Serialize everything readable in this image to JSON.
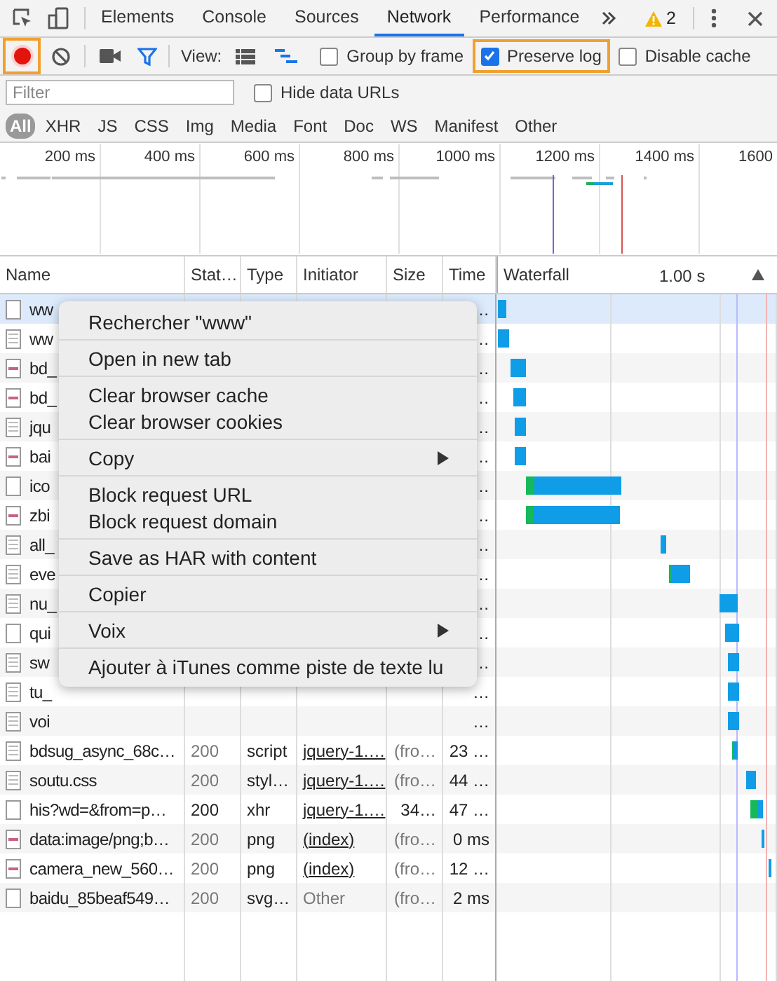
{
  "tab_bar": {
    "tabs": [
      {
        "label": "Elements",
        "selected": false
      },
      {
        "label": "Console",
        "selected": false
      },
      {
        "label": "Sources",
        "selected": false
      },
      {
        "label": "Network",
        "selected": true
      },
      {
        "label": "Performance",
        "selected": false
      }
    ],
    "warning_count": "2"
  },
  "toolbar": {
    "recording": true,
    "record_highlighted": true,
    "view_label": "View:",
    "checkboxes": [
      {
        "label": "Group by frame",
        "checked": false,
        "highlighted": false
      },
      {
        "label": "Preserve log",
        "checked": true,
        "highlighted": true
      },
      {
        "label": "Disable cache",
        "checked": false,
        "highlighted": false
      }
    ]
  },
  "filter": {
    "placeholder": "Filter",
    "hide_data_urls": {
      "label": "Hide data URLs",
      "checked": false
    }
  },
  "type_filters": [
    {
      "label": "All",
      "selected": true
    },
    {
      "label": "XHR",
      "selected": false
    },
    {
      "label": "JS",
      "selected": false
    },
    {
      "label": "CSS",
      "selected": false
    },
    {
      "label": "Img",
      "selected": false
    },
    {
      "label": "Media",
      "selected": false
    },
    {
      "label": "Font",
      "selected": false
    },
    {
      "label": "Doc",
      "selected": false
    },
    {
      "label": "WS",
      "selected": false
    },
    {
      "label": "Manifest",
      "selected": false
    },
    {
      "label": "Other",
      "selected": false
    }
  ],
  "overview": {
    "ticks": [
      "200 ms",
      "400 ms",
      "600 ms",
      "800 ms",
      "1000 ms",
      "1200 ms",
      "1400 ms",
      "1600"
    ]
  },
  "table": {
    "columns": [
      "Name",
      "Stat…",
      "Type",
      "Initiator",
      "Size",
      "Time",
      "Waterfall"
    ],
    "waterfall_scale": "1.00 s",
    "rows": [
      {
        "name": "ww",
        "time": "…",
        "kind": "blank",
        "selected": true
      },
      {
        "name": "ww",
        "time": "…",
        "kind": "doc",
        "selected": false
      },
      {
        "name": "bd_",
        "time": "…",
        "kind": "image",
        "selected": false
      },
      {
        "name": "bd_",
        "time": "…",
        "kind": "image",
        "selected": false
      },
      {
        "name": "jqu",
        "time": "…",
        "kind": "doc",
        "selected": false
      },
      {
        "name": "bai",
        "time": "…",
        "kind": "image",
        "selected": false
      },
      {
        "name": "ico",
        "time": "…",
        "kind": "blank",
        "selected": false
      },
      {
        "name": "zbi",
        "time": "…",
        "kind": "image",
        "selected": false
      },
      {
        "name": "all_",
        "time": "…",
        "kind": "doc",
        "selected": false
      },
      {
        "name": "eve",
        "time": "…",
        "kind": "doc",
        "selected": false
      },
      {
        "name": "nu_",
        "time": "…",
        "kind": "doc",
        "selected": false
      },
      {
        "name": "qui",
        "time": "…",
        "kind": "blank",
        "selected": false
      },
      {
        "name": "sw",
        "time": "…",
        "kind": "doc",
        "selected": false
      },
      {
        "name": "tu_",
        "time": "…",
        "kind": "doc",
        "selected": false
      },
      {
        "name": "voi",
        "time": "…",
        "kind": "doc",
        "selected": false
      },
      {
        "name": "bdsug_async_68c…",
        "status": "200",
        "type": "script",
        "initiator": "jquery-1.…",
        "initiator_link": true,
        "size": "(fro…",
        "time": "23 …",
        "kind": "doc",
        "cached": true,
        "selected": false
      },
      {
        "name": "soutu.css",
        "status": "200",
        "type": "styl…",
        "initiator": "jquery-1.…",
        "initiator_link": true,
        "size": "(fro…",
        "time": "44 …",
        "kind": "doc",
        "cached": true,
        "selected": false
      },
      {
        "name": "his?wd=&from=p…",
        "status": "200",
        "type": "xhr",
        "initiator": "jquery-1.…",
        "initiator_link": true,
        "size": "34…",
        "time": "47 …",
        "kind": "blank",
        "cached": false,
        "selected": false
      },
      {
        "name": "data:image/png;b…",
        "status": "200",
        "type": "png",
        "initiator": "(index)",
        "initiator_link": true,
        "size": "(fro…",
        "time": "0 ms",
        "kind": "image",
        "cached": true,
        "selected": false
      },
      {
        "name": "camera_new_560…",
        "status": "200",
        "type": "png",
        "initiator": "(index)",
        "initiator_link": true,
        "size": "(fro…",
        "time": "12 …",
        "kind": "image",
        "cached": true,
        "selected": false
      },
      {
        "name": "baidu_85beaf549…",
        "status": "200",
        "type": "svg…",
        "initiator": "Other",
        "initiator_link": false,
        "size": "(fro…",
        "time": "2 ms",
        "kind": "blank",
        "cached": true,
        "selected": false
      }
    ]
  },
  "context_menu": {
    "groups": [
      [
        {
          "label": "Rechercher \"www\"",
          "submenu": false
        }
      ],
      [
        {
          "label": "Open in new tab",
          "submenu": false
        }
      ],
      [
        {
          "label": "Clear browser cache",
          "submenu": false
        },
        {
          "label": "Clear browser cookies",
          "submenu": false
        }
      ],
      [
        {
          "label": "Copy",
          "submenu": true
        }
      ],
      [
        {
          "label": "Block request URL",
          "submenu": false
        },
        {
          "label": "Block request domain",
          "submenu": false
        }
      ],
      [
        {
          "label": "Save as HAR with content",
          "submenu": false
        }
      ],
      [
        {
          "label": "Copier",
          "submenu": false
        }
      ],
      [
        {
          "label": "Voix",
          "submenu": true
        }
      ],
      [
        {
          "label": "Ajouter à iTunes comme piste de texte lu",
          "submenu": false
        }
      ]
    ]
  }
}
